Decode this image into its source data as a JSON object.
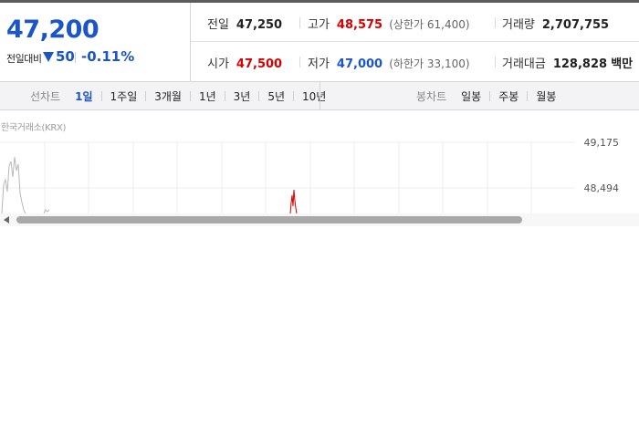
{
  "quote": {
    "price": "47,200",
    "change_label": "전일대비",
    "change_amount": "50",
    "change_rate": "-0.11%",
    "prev_close": {
      "label": "전일",
      "value": "47,250"
    },
    "high": {
      "label": "고가",
      "value": "48,575",
      "limit_label": "상한가",
      "limit_value": "61,400"
    },
    "volume": {
      "label": "거래량",
      "value": "2,707,755"
    },
    "open": {
      "label": "시가",
      "value": "47,500"
    },
    "low": {
      "label": "저가",
      "value": "47,000",
      "limit_label": "하한가",
      "limit_value": "33,100"
    },
    "amount": {
      "label": "거래대금",
      "value": "128,828",
      "unit": "백만"
    }
  },
  "tabs": {
    "line_title": "선차트",
    "line_items": [
      "1일",
      "1주일",
      "3개월",
      "1년",
      "3년",
      "5년",
      "10년"
    ],
    "line_active": "1일",
    "candle_title": "봉차트",
    "candle_items": [
      "일봉",
      "주봉",
      "월봉"
    ]
  },
  "chart": {
    "source": "한국거래소(KRX)",
    "yticks": [
      "49,175",
      "48,494"
    ]
  },
  "colors": {
    "up": "#d60000",
    "down": "#1a56c8",
    "accent": "#1a56c8"
  }
}
